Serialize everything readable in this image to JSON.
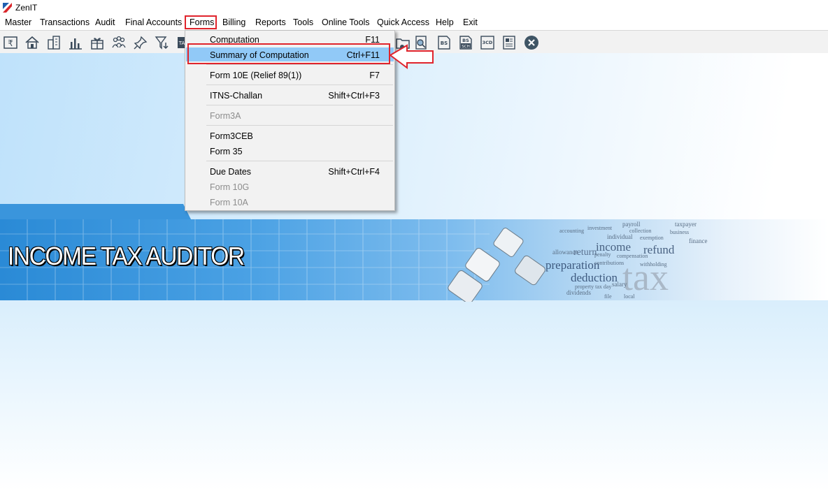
{
  "window": {
    "title": "ZenIT"
  },
  "menubar": {
    "items": [
      "Master",
      "Transactions",
      "Audit",
      "Final Accounts",
      "Forms",
      "Billing",
      "Reports",
      "Tools",
      "Online Tools",
      "Quick Access",
      "Help",
      "Exit"
    ],
    "active": "Forms"
  },
  "toolbar": {
    "icons": [
      "rupee-icon",
      "home-icon",
      "building-icon",
      "bar-chart-icon",
      "gift-icon",
      "people-icon",
      "pin-icon",
      "filter-icon",
      "ta-icon",
      "folder-icon",
      "search-doc-icon",
      "bs-icon",
      "bs-sch-icon",
      "3cd-icon",
      "report-icon",
      "close-circle-icon"
    ],
    "labels": {
      "bs": "BS",
      "bs_sch_top": "BS",
      "bs_sch_bottom": "SCH",
      "cd": "3CD",
      "ta": "TA"
    }
  },
  "forms_menu": {
    "items": [
      {
        "label": "Computation",
        "shortcut": "F11",
        "enabled": true
      },
      {
        "label": "Summary of Computation",
        "shortcut": "Ctrl+F11",
        "enabled": true,
        "highlighted": true
      },
      {
        "label": "Form 10E (Relief 89(1))",
        "shortcut": "F7",
        "enabled": true
      },
      {
        "label": "ITNS-Challan",
        "shortcut": "Shift+Ctrl+F3",
        "enabled": true
      },
      {
        "label": "Form3A",
        "shortcut": "",
        "enabled": false
      },
      {
        "label": "Form3CEB",
        "shortcut": "",
        "enabled": true
      },
      {
        "label": "Form 35",
        "shortcut": "",
        "enabled": true
      },
      {
        "label": "Due Dates",
        "shortcut": "Shift+Ctrl+F4",
        "enabled": true
      },
      {
        "label": "Form 10G",
        "shortcut": "",
        "enabled": false
      },
      {
        "label": "Form 10A",
        "shortcut": "",
        "enabled": false
      }
    ]
  },
  "banner": {
    "title": "INCOME TAX AUDITOR",
    "words": [
      "income",
      "refund",
      "preparation",
      "deduction",
      "tax",
      "payroll",
      "taxpayer",
      "salary",
      "dividends",
      "return",
      "individual",
      "finance",
      "investment",
      "accounting",
      "allowance",
      "penalty",
      "compensation",
      "contributions",
      "property tax day",
      "local",
      "file",
      "exemption",
      "collection",
      "business",
      "withholding"
    ]
  },
  "colors": {
    "highlight": "#91c9f7",
    "annotation_red": "#e0242c",
    "banner_blue": "#3a95dc"
  }
}
